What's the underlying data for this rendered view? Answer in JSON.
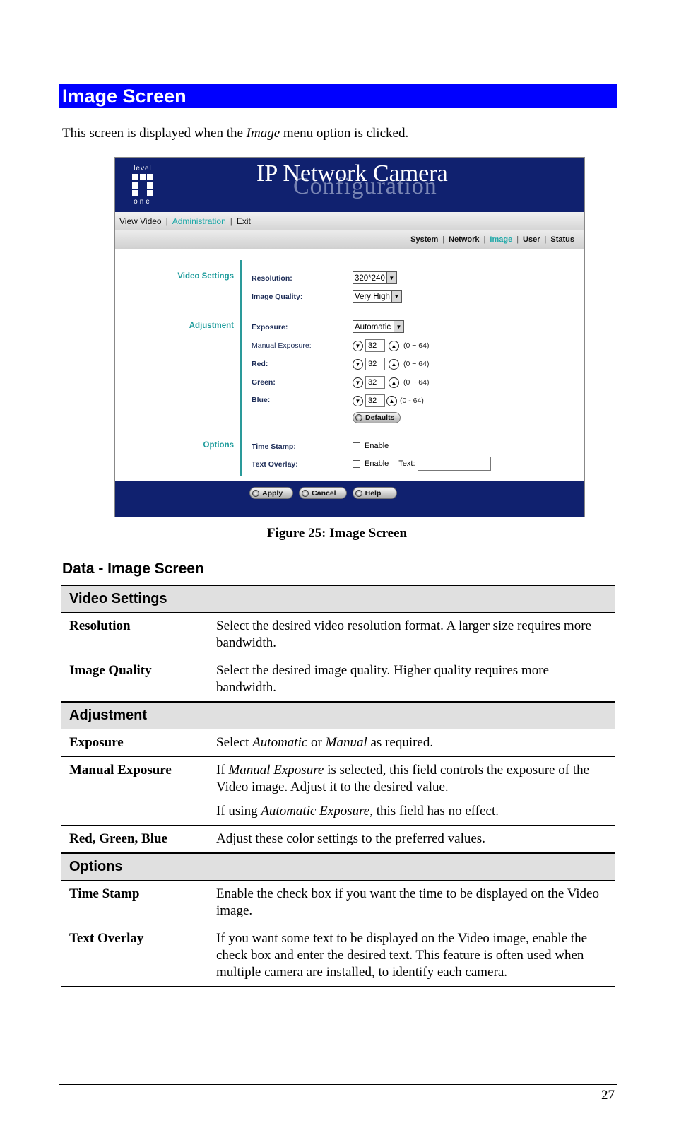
{
  "section_heading": "Image Screen",
  "intro": {
    "before": "This screen is displayed when the ",
    "em": "Image",
    "after": " menu option is clicked."
  },
  "figure": {
    "caption": "Figure 25: Image Screen",
    "screen": {
      "logo": {
        "top": "level",
        "bottom": "one"
      },
      "title": "IP Network Camera",
      "subtitle": "Configuration",
      "main_nav": [
        {
          "label": "View Video",
          "active": false
        },
        {
          "label": "Administration",
          "active": true
        },
        {
          "label": "Exit",
          "active": false
        }
      ],
      "sub_nav": [
        {
          "label": "System",
          "active": false
        },
        {
          "label": "Network",
          "active": false
        },
        {
          "label": "Image",
          "active": true
        },
        {
          "label": "User",
          "active": false
        },
        {
          "label": "Status",
          "active": false
        }
      ],
      "groups": {
        "video_settings": "Video Settings",
        "adjustment": "Adjustment",
        "options": "Options"
      },
      "fields": {
        "resolution": {
          "label": "Resolution:",
          "value": "320*240"
        },
        "image_quality": {
          "label": "Image Quality:",
          "value": "Very High"
        },
        "exposure": {
          "label": "Exposure:",
          "value": "Automatic"
        },
        "manual_exposure": {
          "label": "Manual Exposure:",
          "value": "32",
          "range": "(0 ~ 64)"
        },
        "red": {
          "label": "Red:",
          "value": "32",
          "range": "(0 ~ 64)"
        },
        "green": {
          "label": "Green:",
          "value": "32",
          "range": "(0 ~ 64)"
        },
        "blue": {
          "label": "Blue:",
          "value": "32",
          "range": "(0 - 64)"
        },
        "defaults_button": "Defaults",
        "time_stamp": {
          "label": "Time Stamp:",
          "checkbox_label": "Enable",
          "checked": false
        },
        "text_overlay": {
          "label": "Text Overlay:",
          "checkbox_label": "Enable",
          "checked": false,
          "text_label": "Text:",
          "text_value": ""
        }
      },
      "buttons": {
        "apply": "Apply",
        "cancel": "Cancel",
        "help": "Help"
      }
    }
  },
  "data_heading": "Data - Image Screen",
  "table": {
    "sections": [
      {
        "title": "Video Settings",
        "rows": [
          {
            "key": "Resolution",
            "value": "Select the desired video resolution format. A larger size requires more bandwidth."
          },
          {
            "key": "Image Quality",
            "value": "Select the desired image quality. Higher quality requires more bandwidth."
          }
        ]
      },
      {
        "title": "Adjustment",
        "rows": [
          {
            "key": "Exposure",
            "parts": {
              "p1": "Select ",
              "em1": "Automatic",
              "p2": " or ",
              "em2": "Manual",
              "p3": " as required."
            }
          },
          {
            "key": "Manual Exposure",
            "para1": {
              "p1": "If ",
              "em1": "Manual Exposure",
              "p2": " is selected, this field controls the exposure of the Video image. Adjust it to the desired value."
            },
            "para2": {
              "p1": "If using ",
              "em1": "Automatic Exposure",
              "p2": ", this field has no effect."
            }
          },
          {
            "key": "Red, Green, Blue",
            "value": "Adjust these color settings to the preferred values."
          }
        ]
      },
      {
        "title": "Options",
        "rows": [
          {
            "key": "Time Stamp",
            "value": "Enable the check box if you want the time to be displayed on the Video image."
          },
          {
            "key": "Text Overlay",
            "value": "If you want some text to be displayed on the Video image, enable the check box and enter the desired text. This feature is often used when multiple camera are installed, to identify each camera."
          }
        ]
      }
    ]
  },
  "page_number": "27",
  "colors": {
    "heading_bar": "#0000ff",
    "camera_navy": "#10216f",
    "camera_accent": "#1ea8a8",
    "table_section_bg": "#e0e0e0"
  }
}
